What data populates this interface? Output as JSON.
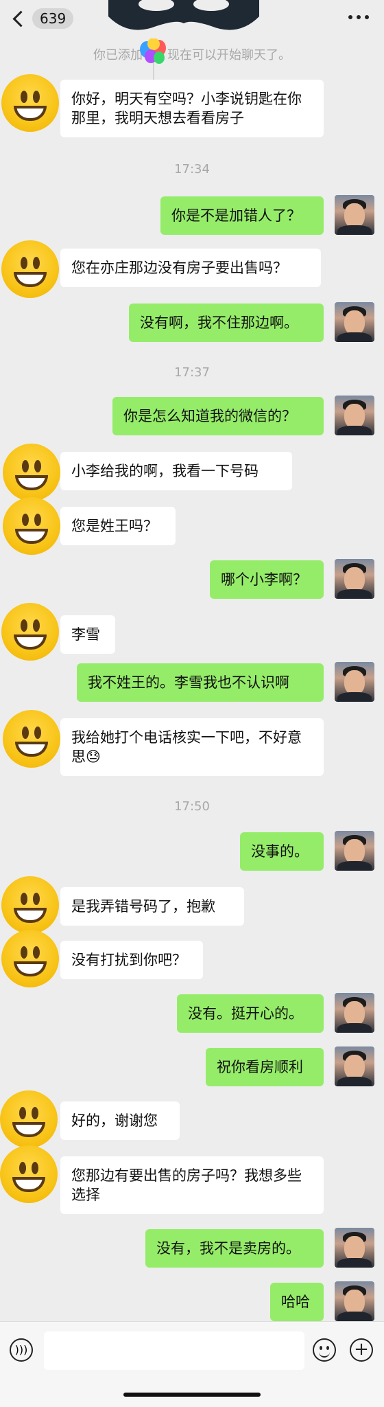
{
  "header": {
    "back_count": "639"
  },
  "system_notice": "你已添加了，现在可以开始聊天了。",
  "times": [
    "17:34",
    "17:37",
    "17:50"
  ],
  "messages": [
    {
      "side": "in",
      "text": "你好，明天有空吗？小李说钥匙在你那里，我明天想去看看房子"
    },
    {
      "side": "out",
      "text": "你是不是加错人了？"
    },
    {
      "side": "in",
      "text": "您在亦庄那边没有房子要出售吗？"
    },
    {
      "side": "out",
      "text": "没有啊，我不住那边啊。"
    },
    {
      "side": "out",
      "text": "你是怎么知道我的微信的？"
    },
    {
      "side": "in",
      "text": "小李给我的啊，我看一下号码"
    },
    {
      "side": "in",
      "text": "您是姓王吗？"
    },
    {
      "side": "out",
      "text": "哪个小李啊？"
    },
    {
      "side": "in",
      "text": "李雪"
    },
    {
      "side": "out",
      "text": "我不姓王的。李雪我也不认识啊"
    },
    {
      "side": "in",
      "text": "我给她打个电话核实一下吧，不好意思😓"
    },
    {
      "side": "out",
      "text": "没事的。"
    },
    {
      "side": "in",
      "text": "是我弄错号码了，抱歉"
    },
    {
      "side": "in",
      "text": "没有打扰到你吧？"
    },
    {
      "side": "out",
      "text": "没有。挺开心的。"
    },
    {
      "side": "out",
      "text": "祝你看房顺利"
    },
    {
      "side": "in",
      "text": "好的，谢谢您"
    },
    {
      "side": "in",
      "text": "您那边有要出售的房子吗？我想多些选择"
    },
    {
      "side": "out",
      "text": "没有，我不是卖房的。"
    },
    {
      "side": "out",
      "text": "哈哈"
    }
  ],
  "input": {
    "placeholder": "",
    "value": ""
  },
  "icons": {
    "back": "chevron-left-icon",
    "more": "more-dots-icon",
    "voice": "voice-icon",
    "emoji": "emoji-icon",
    "plus": "plus-icon",
    "balloon": "balloon-icon",
    "mask": "mask-icon"
  },
  "colors": {
    "background": "#ededed",
    "incoming": "#ffffff",
    "outgoing": "#95ec69"
  }
}
